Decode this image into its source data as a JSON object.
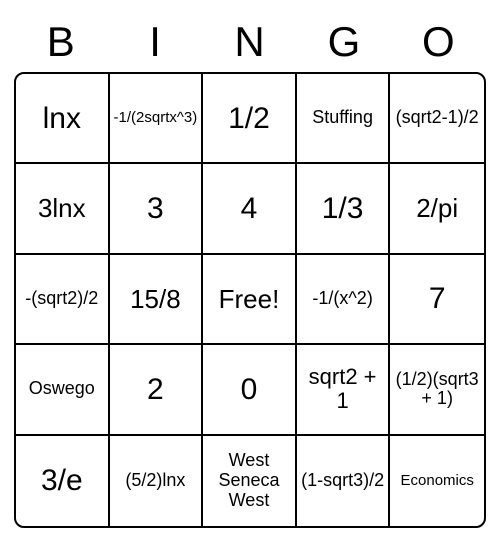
{
  "header": [
    "B",
    "I",
    "N",
    "G",
    "O"
  ],
  "cells": [
    [
      {
        "text": "lnx",
        "size": "xl"
      },
      {
        "text": "-1/(2sqrtx^3)",
        "size": "xs"
      },
      {
        "text": "1/2",
        "size": "xl"
      },
      {
        "text": "Stuffing",
        "size": "sm"
      },
      {
        "text": "(sqrt2-1)/2",
        "size": "sm"
      }
    ],
    [
      {
        "text": "3lnx",
        "size": "lg"
      },
      {
        "text": "3",
        "size": "xl"
      },
      {
        "text": "4",
        "size": "xl"
      },
      {
        "text": "1/3",
        "size": "xl"
      },
      {
        "text": "2/pi",
        "size": "lg"
      }
    ],
    [
      {
        "text": "-(sqrt2)/2",
        "size": "sm"
      },
      {
        "text": "15/8",
        "size": "lg"
      },
      {
        "text": "Free!",
        "size": "lg"
      },
      {
        "text": "-1/(x^2)",
        "size": "sm"
      },
      {
        "text": "7",
        "size": "xl"
      }
    ],
    [
      {
        "text": "Oswego",
        "size": "sm"
      },
      {
        "text": "2",
        "size": "xl"
      },
      {
        "text": "0",
        "size": "xl"
      },
      {
        "text": "sqrt2 + 1",
        "size": "md"
      },
      {
        "text": "(1/2)(sqrt3 + 1)",
        "size": "sm"
      }
    ],
    [
      {
        "text": "3/e",
        "size": "xl"
      },
      {
        "text": "(5/2)lnx",
        "size": "sm"
      },
      {
        "text": "West Seneca West",
        "size": "sm"
      },
      {
        "text": "(1-sqrt3)/2",
        "size": "sm"
      },
      {
        "text": "Economics",
        "size": "xs"
      }
    ]
  ]
}
